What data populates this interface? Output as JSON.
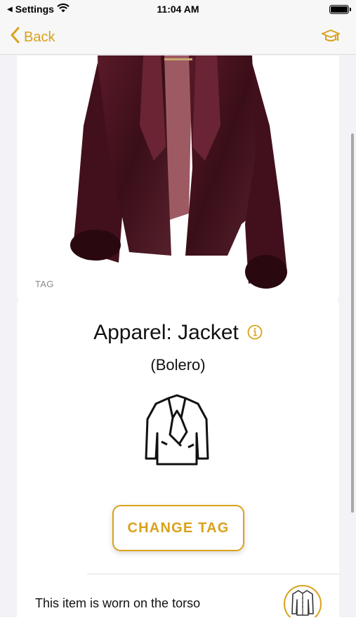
{
  "status_bar": {
    "back_app": "Settings",
    "time": "11:04 AM"
  },
  "nav": {
    "back_label": "Back"
  },
  "photo": {
    "item_color": "#4a1420",
    "lining_color": "#9e5a63"
  },
  "tag_section": {
    "section_label": "TAG",
    "title": "Apparel: Jacket",
    "subtitle": "(Bolero)",
    "change_tag_label": "CHANGE TAG",
    "worn_text": "This item is worn on the torso"
  },
  "colors": {
    "accent": "#d9a21b",
    "background": "#f2f2f7",
    "card": "#ffffff"
  },
  "icons": [
    "wifi-icon",
    "battery-icon",
    "chevron-left-icon",
    "graduation-cap-icon",
    "info-icon",
    "jacket-icon",
    "shirt-icon"
  ]
}
